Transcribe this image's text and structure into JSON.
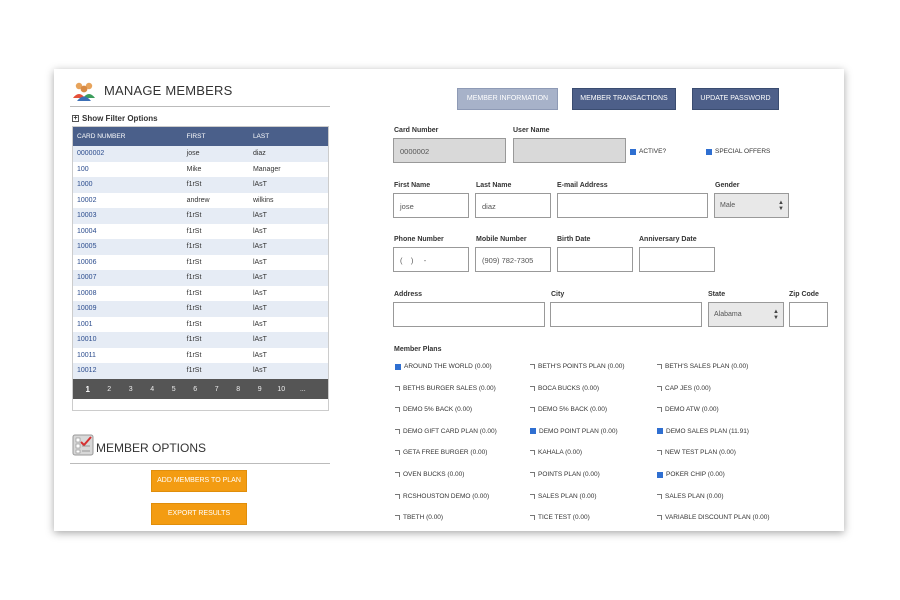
{
  "left": {
    "manage_title": "MANAGE MEMBERS",
    "filter_label": "Show Filter Options",
    "table": {
      "headers": [
        "CARD NUMBER",
        "FIRST",
        "LAST"
      ],
      "rows": [
        [
          "0000002",
          "jose",
          "diaz"
        ],
        [
          "100",
          "Mike",
          "Manager"
        ],
        [
          "1000",
          "f1rSt",
          "lAsT"
        ],
        [
          "10002",
          "andrew",
          "wilkins"
        ],
        [
          "10003",
          "f1rSt",
          "lAsT"
        ],
        [
          "10004",
          "f1rSt",
          "lAsT"
        ],
        [
          "10005",
          "f1rSt",
          "lAsT"
        ],
        [
          "10006",
          "f1rSt",
          "lAsT"
        ],
        [
          "10007",
          "f1rSt",
          "lAsT"
        ],
        [
          "10008",
          "f1rSt",
          "lAsT"
        ],
        [
          "10009",
          "f1rSt",
          "lAsT"
        ],
        [
          "1001",
          "f1rSt",
          "lAsT"
        ],
        [
          "10010",
          "f1rSt",
          "lAsT"
        ],
        [
          "10011",
          "f1rSt",
          "lAsT"
        ],
        [
          "10012",
          "f1rSt",
          "lAsT"
        ]
      ]
    },
    "pager": [
      "1",
      "2",
      "3",
      "4",
      "5",
      "6",
      "7",
      "8",
      "9",
      "10",
      "..."
    ],
    "options_title": "MEMBER OPTIONS",
    "add_button": "ADD MEMBERS TO PLAN",
    "export_button": "EXPORT RESULTS"
  },
  "tabs": {
    "info": "MEMBER INFORMATION",
    "transactions": "MEMBER TRANSACTIONS",
    "password": "UPDATE PASSWORD"
  },
  "form": {
    "card_number": {
      "label": "Card Number",
      "value": "0000002"
    },
    "user_name": {
      "label": "User Name",
      "value": ""
    },
    "active": {
      "label": "ACTIVE?",
      "checked": true
    },
    "special_offers": {
      "label": "SPECIAL OFFERS",
      "checked": true
    },
    "first_name": {
      "label": "First Name",
      "value": "jose"
    },
    "last_name": {
      "label": "Last Name",
      "value": "diaz"
    },
    "email": {
      "label": "E-mail Address",
      "value": ""
    },
    "gender": {
      "label": "Gender",
      "value": "Male"
    },
    "phone": {
      "label": "Phone Number",
      "value": "(    )     -"
    },
    "mobile": {
      "label": "Mobile Number",
      "value": "(909) 782-7305"
    },
    "birth_date": {
      "label": "Birth Date",
      "value": ""
    },
    "anniversary": {
      "label": "Anniversary Date",
      "value": ""
    },
    "address": {
      "label": "Address",
      "value": ""
    },
    "city": {
      "label": "City",
      "value": ""
    },
    "state": {
      "label": "State",
      "value": "Alabama"
    },
    "zip": {
      "label": "Zip Code",
      "value": ""
    }
  },
  "plans_label": "Member Plans",
  "plans": [
    {
      "name": "AROUND THE WORLD (0.00)",
      "checked": true
    },
    {
      "name": "BETH'S POINTS PLAN (0.00)",
      "checked": false
    },
    {
      "name": "BETH'S SALES PLAN (0.00)",
      "checked": false
    },
    {
      "name": "BETHS BURGER SALES (0.00)",
      "checked": false
    },
    {
      "name": "BOCA BUCKS (0.00)",
      "checked": false
    },
    {
      "name": "CAP JES (0.00)",
      "checked": false
    },
    {
      "name": "DEMO 5% BACK (0.00)",
      "checked": false
    },
    {
      "name": "DEMO 5% BACK (0.00)",
      "checked": false
    },
    {
      "name": "DEMO ATW (0.00)",
      "checked": false
    },
    {
      "name": "DEMO GIFT CARD PLAN (0.00)",
      "checked": false
    },
    {
      "name": "DEMO POINT PLAN (0.00)",
      "checked": true
    },
    {
      "name": "DEMO SALES PLAN (11.91)",
      "checked": true
    },
    {
      "name": "GETA FREE BURGER (0.00)",
      "checked": false
    },
    {
      "name": "KAHALA (0.00)",
      "checked": false
    },
    {
      "name": "NEW TEST PLAN (0.00)",
      "checked": false
    },
    {
      "name": "OVEN BUCKS (0.00)",
      "checked": false
    },
    {
      "name": "POINTS PLAN (0.00)",
      "checked": false
    },
    {
      "name": "POKER CHIP (0.00)",
      "checked": true
    },
    {
      "name": "RCSHOUSTON DEMO (0.00)",
      "checked": false
    },
    {
      "name": "SALES PLAN (0.00)",
      "checked": false
    },
    {
      "name": "SALES PLAN (0.00)",
      "checked": false
    },
    {
      "name": "TBETH (0.00)",
      "checked": false
    },
    {
      "name": "TICE TEST (0.00)",
      "checked": false
    },
    {
      "name": "VARIABLE DISCOUNT PLAN (0.00)",
      "checked": false
    }
  ],
  "colors": {
    "header_blue": "#4a5f8a",
    "tab_active": "#a7b2c9",
    "tab_dark": "#4d5f89",
    "orange": "#f39c12",
    "pager_bg": "#555555",
    "row_alt": "#e6ecf5"
  },
  "icons": {
    "manage": "users-group-icon",
    "options": "checklist-icon",
    "filter": "plus-square-icon",
    "select": "updown-arrow-icon",
    "plan_check": "checkbox-icon"
  }
}
